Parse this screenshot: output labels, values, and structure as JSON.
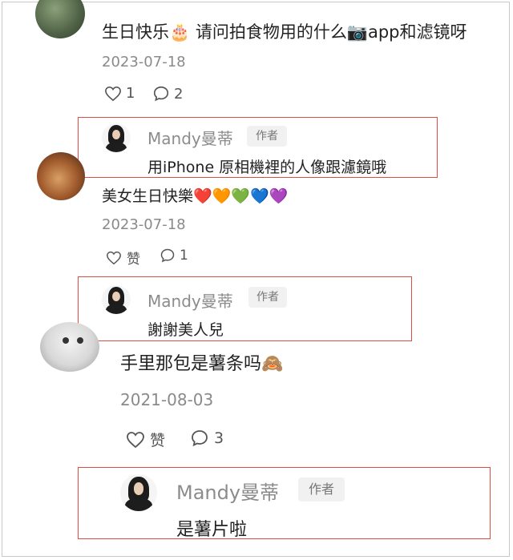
{
  "comments": [
    {
      "text": "生日快乐🎂 请问拍食物用的什么📷app和滤镜呀",
      "date": "2023-07-18",
      "like_label": "1",
      "reply_count": "2",
      "reply": {
        "author": "Mandy曼蒂",
        "tag": "作者",
        "text": "用iPhone 原相機裡的人像跟濾鏡哦"
      }
    },
    {
      "text": "美女生日快樂❤️🧡💚💙💜",
      "date": "2023-07-18",
      "like_label": "赞",
      "reply_count": "1",
      "reply": {
        "author": "Mandy曼蒂",
        "tag": "作者",
        "text": "謝謝美人兒"
      }
    },
    {
      "text": "手里那包是薯条吗🙈",
      "date": "2021-08-03",
      "like_label": "赞",
      "reply_count": "3",
      "reply": {
        "author": "Mandy曼蒂",
        "tag": "作者",
        "text": "是薯片啦"
      }
    }
  ],
  "colors": {
    "highlight_border": "#e04b43",
    "muted_text": "#8a8a8a"
  },
  "icons": {
    "like": "heart-outline-icon",
    "reply": "speech-bubble-icon"
  }
}
